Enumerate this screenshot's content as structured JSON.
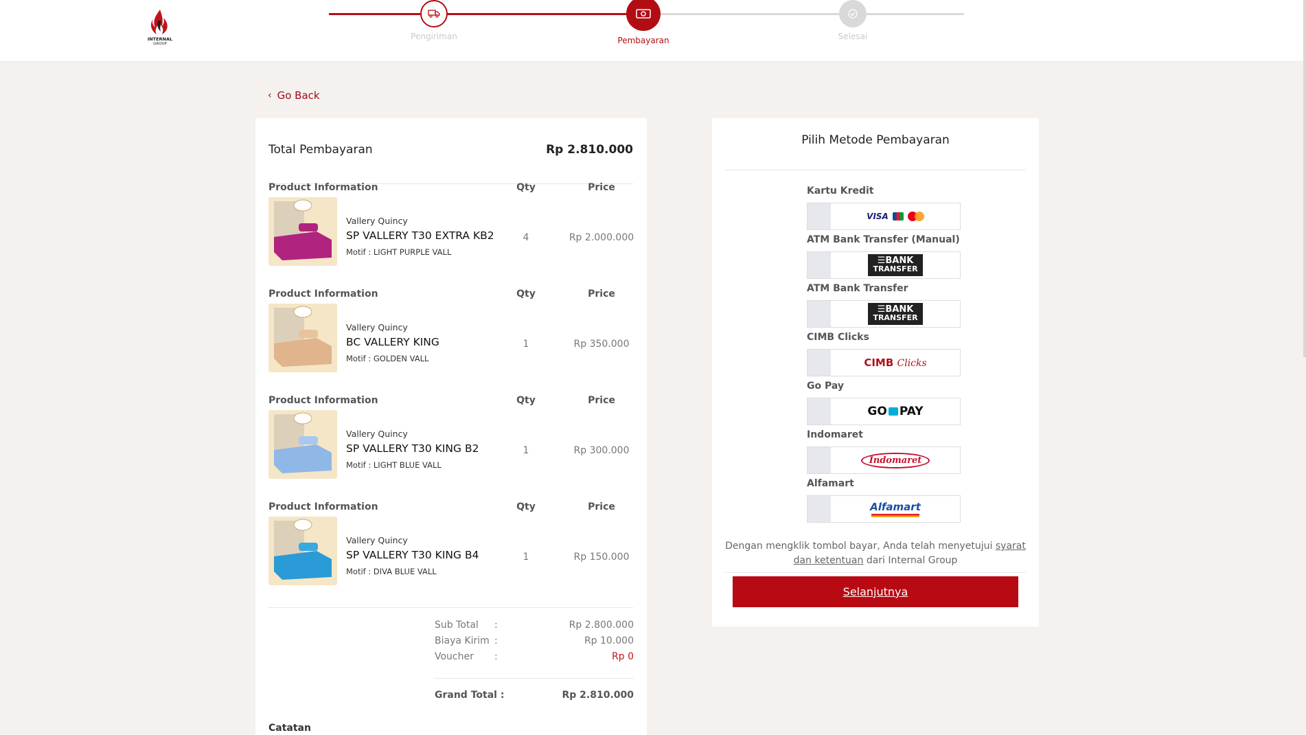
{
  "brand": {
    "logo_text": "INTERNAL",
    "logo_sub": "GROUP"
  },
  "steps": [
    {
      "label": "Pengiriman",
      "state": "done",
      "icon": "truck-icon"
    },
    {
      "label": "Pembayaran",
      "state": "active",
      "icon": "money-icon"
    },
    {
      "label": "Selesai",
      "state": "pending",
      "icon": "check-icon"
    }
  ],
  "colors": {
    "accent": "#b80a13",
    "active_step": "#b30d14",
    "inactive": "#d9d9d9"
  },
  "nav": {
    "go_back": "Go Back"
  },
  "summary": {
    "total_label": "Total Pembayaran",
    "total_value": "Rp 2.810.000",
    "col_product": "Product Information",
    "col_qty": "Qty",
    "col_price": "Price"
  },
  "products": [
    {
      "brand": "Vallery Quincy",
      "name": "SP VALLERY T30 EXTRA KB2",
      "motif": "Motif : LIGHT PURPLE VALL",
      "qty": "4",
      "price": "Rp 2.000.000",
      "color": "#b0247f"
    },
    {
      "brand": "Vallery Quincy",
      "name": "BC VALLERY KING",
      "motif": "Motif : GOLDEN VALL",
      "qty": "1",
      "price": "Rp 350.000",
      "color": "#e0b48c"
    },
    {
      "brand": "Vallery Quincy",
      "name": "SP VALLERY T30 KING B2",
      "motif": "Motif : LIGHT BLUE VALL",
      "qty": "1",
      "price": "Rp 300.000",
      "color": "#8fb8e6"
    },
    {
      "brand": "Vallery Quincy",
      "name": "SP VALLERY T30 KING B4",
      "motif": "Motif : DIVA BLUE VALL",
      "qty": "1",
      "price": "Rp 150.000",
      "color": "#2a9bd6"
    }
  ],
  "totals": {
    "subtotal_label": "Sub Total",
    "subtotal_value": "Rp 2.800.000",
    "shipping_label": "Biaya Kirim",
    "shipping_value": "Rp 10.000",
    "voucher_label": "Voucher",
    "voucher_value": "Rp 0",
    "colon": ":",
    "grand_label": "Grand Total :",
    "grand_value": "Rp 2.810.000"
  },
  "notes_label": "Catatan",
  "payment": {
    "title": "Pilih Metode Pembayaran",
    "methods": [
      {
        "label": "Kartu Kredit",
        "logo": "credit-card-logos"
      },
      {
        "label": "ATM Bank Transfer (Manual)",
        "logo": "bank-transfer-logo"
      },
      {
        "label": "ATM Bank Transfer",
        "logo": "bank-transfer-logo"
      },
      {
        "label": "CIMB Clicks",
        "logo": "cimb-clicks-logo"
      },
      {
        "label": "Go Pay",
        "logo": "gopay-logo"
      },
      {
        "label": "Indomaret",
        "logo": "indomaret-logo"
      },
      {
        "label": "Alfamart",
        "logo": "alfamart-logo"
      }
    ],
    "logo_text": {
      "visa": "VISA",
      "bank_1": "☰BANK",
      "bank_2": "TRANSFER",
      "cimb": "CIMB",
      "cimb_clicks": "Clicks",
      "gopay_go": "GO",
      "gopay_pay": "PAY",
      "indomaret": "Indomaret",
      "alfamart": "Alfamart"
    },
    "terms_prefix": "Dengan mengklik tombol bayar, Anda telah menyetujui",
    "terms_link": "syarat dan ketentuan",
    "terms_suffix": "dari Internal Group",
    "next_label": "Selanjutnya"
  }
}
